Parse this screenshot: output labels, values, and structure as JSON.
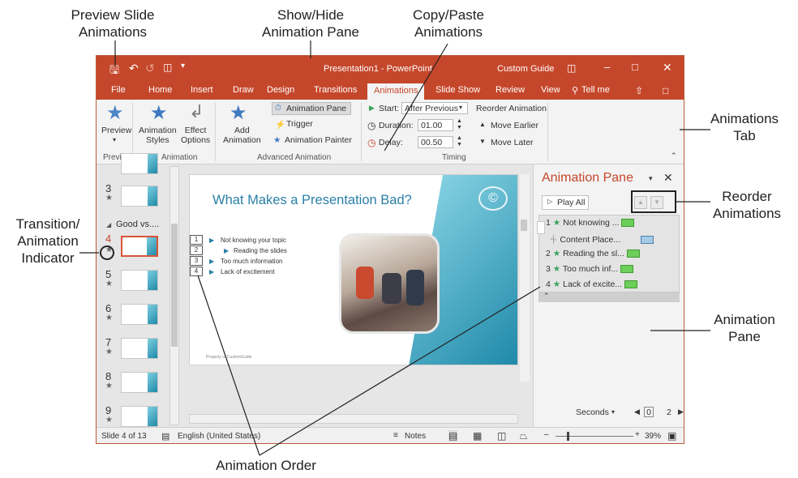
{
  "callouts": {
    "preview_slide_animations": "Preview Slide\nAnimations",
    "show_hide_pane": "Show/Hide\nAnimation Pane",
    "copy_paste": "Copy/Paste\nAnimations",
    "animations_tab": "Animations\nTab",
    "reorder": "Reorder\nAnimations",
    "transition_indicator": "Transition/\nAnimation\nIndicator",
    "animation_pane": "Animation\nPane",
    "animation_order": "Animation Order"
  },
  "window": {
    "title": "Presentation1 - PowerPoint",
    "account": "Custom Guide",
    "tabs": [
      "File",
      "Home",
      "Insert",
      "Draw",
      "Design",
      "Transitions",
      "Animations",
      "Slide Show",
      "Review",
      "View"
    ],
    "active_tab": "Animations",
    "tell_me": "Tell me"
  },
  "ribbon": {
    "preview": "Preview",
    "animation_styles": "Animation\nStyles",
    "effect_options": "Effect\nOptions",
    "add_animation": "Add\nAnimation",
    "animation_pane_btn": "Animation Pane",
    "trigger": "Trigger",
    "animation_painter": "Animation Painter",
    "start_label": "Start:",
    "start_value": "After Previous",
    "duration_label": "Duration:",
    "duration_value": "01.00",
    "delay_label": "Delay:",
    "delay_value": "00.50",
    "reorder_title": "Reorder Animation",
    "move_earlier": "Move Earlier",
    "move_later": "Move Later",
    "groups": {
      "preview": "Preview",
      "animation": "Animation",
      "advanced": "Advanced Animation",
      "timing": "Timing"
    }
  },
  "thumbnails": {
    "section": "Good vs....",
    "slides": [
      "3",
      "4",
      "5",
      "6",
      "7",
      "8",
      "9"
    ]
  },
  "slide": {
    "title": "What Makes a Presentation Bad?",
    "bullets": [
      {
        "num": "1",
        "text": "Not knowing your topic"
      },
      {
        "num": "2",
        "text": "Reading the slides"
      },
      {
        "num": "3",
        "text": "Too much information"
      },
      {
        "num": "4",
        "text": "Lack of excitement"
      }
    ],
    "footer": "Property of CustomGuide"
  },
  "animation_pane": {
    "title": "Animation Pane",
    "play_all": "Play All",
    "items": [
      {
        "num": "1",
        "label": "Not knowing ...",
        "kind": "green"
      },
      {
        "num": "",
        "label": "Content Place...",
        "kind": "blue"
      },
      {
        "num": "2",
        "label": "Reading the sl...",
        "kind": "green"
      },
      {
        "num": "3",
        "label": "Too much inf...",
        "kind": "green"
      },
      {
        "num": "4",
        "label": "Lack of excite...",
        "kind": "green"
      }
    ],
    "seconds": "Seconds",
    "timeline_start": "0",
    "timeline_end": "2"
  },
  "status": {
    "slide_of": "Slide 4 of 13",
    "language": "English (United States)",
    "notes": "Notes",
    "zoom": "39%"
  },
  "colors": {
    "accent": "#c5472b",
    "anim_green": "#6ccf5a",
    "slide_title": "#2a7fa8"
  }
}
